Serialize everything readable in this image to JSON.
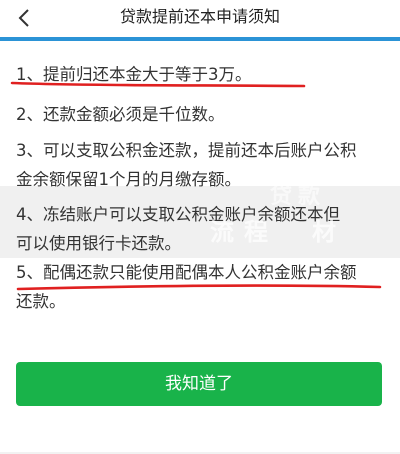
{
  "header": {
    "title": "贷款提前还本申请须知"
  },
  "notices": [
    {
      "line1": "1、提前归还本金大于等于3万。"
    },
    {
      "line1": "2、还款金额必须是千位数。"
    },
    {
      "line1": "3、可以支取公积金还款，提前还本后账户公积",
      "line2": "金余额保留1个月的月缴存额。"
    },
    {
      "line1": "4、冻结账户可以支取公积金账户余额还本但",
      "line2": "可以使用银行卡还款。"
    },
    {
      "line1": "5、配偶还款只能使用配偶本人公积金账户余额",
      "line2": "还款。"
    }
  ],
  "watermark": {
    "text": "流程　材",
    "text2": "贷款"
  },
  "button": {
    "label": "我知道了"
  },
  "colors": {
    "accent_blue": "#2b93d6",
    "button_green": "#19b34a",
    "highlight_red": "#e02020"
  }
}
